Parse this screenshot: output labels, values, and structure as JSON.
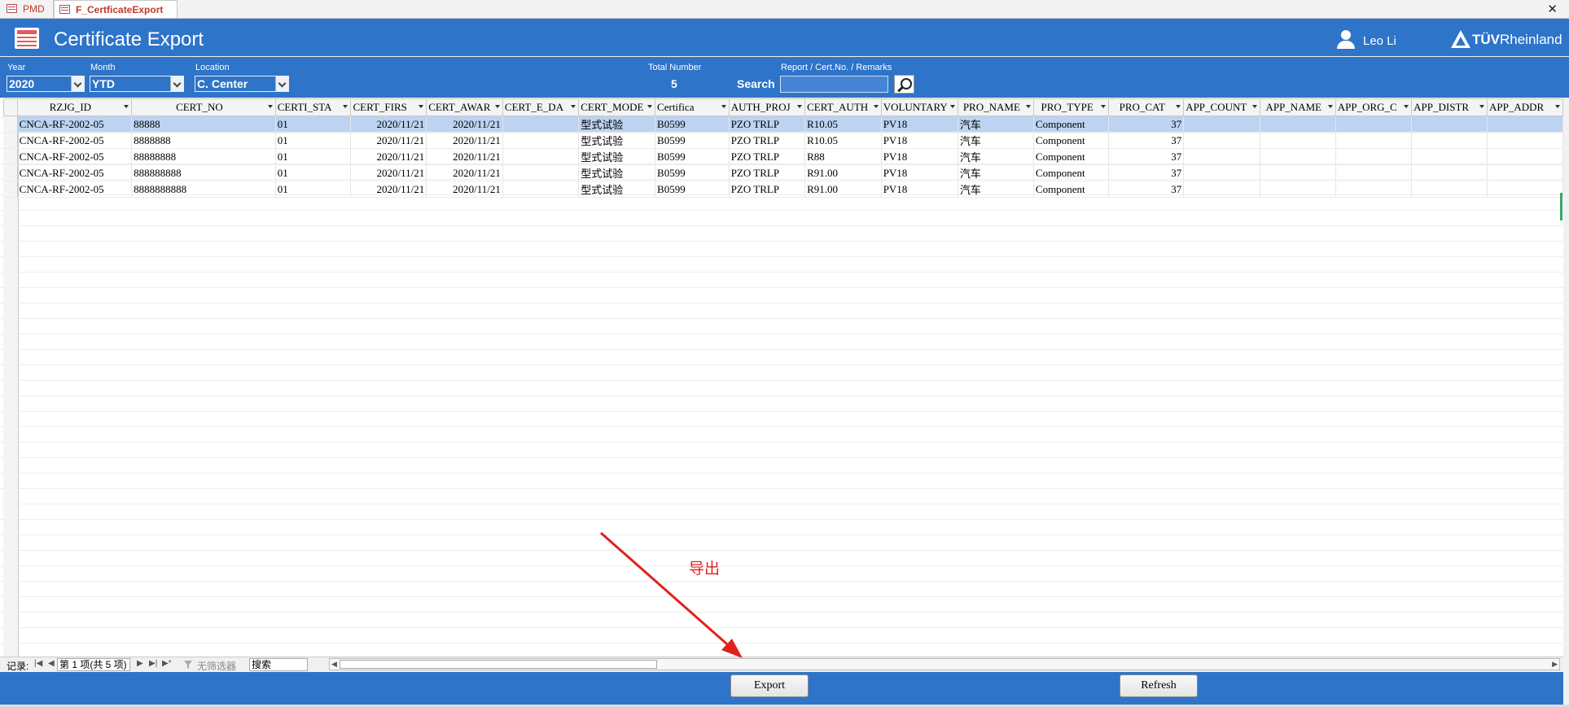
{
  "tabs": [
    {
      "label": "PMD"
    },
    {
      "label": "F_CertficateExport"
    }
  ],
  "header": {
    "title": "Certificate Export",
    "user_name": "Leo Li",
    "logo_text_bold": "TÜV",
    "logo_text_rest": "Rheinland"
  },
  "filters": {
    "year_label": "Year",
    "year_value": "2020",
    "month_label": "Month",
    "month_value": "YTD",
    "location_label": "Location",
    "location_value": "C. Center",
    "total_label": "Total Number",
    "total_value": "5",
    "search_label": "Search",
    "search_field_label": "Report / Cert.No. / Remarks",
    "search_value": ""
  },
  "grid": {
    "columns": [
      "RZJG_ID",
      "CERT_NO",
      "CERTI_STA",
      "CERT_FIRS",
      "CERT_AWAR",
      "CERT_E_DA",
      "CERT_MODE",
      "Certifica",
      "AUTH_PROJ",
      "CERT_AUTH",
      "VOLUNTARY",
      "PRO_NAME",
      "PRO_TYPE",
      "PRO_CAT",
      "APP_COUNT",
      "APP_NAME",
      "APP_ORG_C",
      "APP_DISTR",
      "APP_ADDR"
    ],
    "rows": [
      [
        "CNCA-RF-2002-05",
        "88888",
        "01",
        "2020/11/21",
        "2020/11/21",
        "",
        "型式试验",
        "B0599",
        "PZO TRLP",
        "R10.05",
        "PV18",
        "汽车",
        "Component",
        "37",
        "",
        "",
        "",
        "",
        ""
      ],
      [
        "CNCA-RF-2002-05",
        "8888888",
        "01",
        "2020/11/21",
        "2020/11/21",
        "",
        "型式试验",
        "B0599",
        "PZO TRLP",
        "R10.05",
        "PV18",
        "汽车",
        "Component",
        "37",
        "",
        "",
        "",
        "",
        ""
      ],
      [
        "CNCA-RF-2002-05",
        "88888888",
        "01",
        "2020/11/21",
        "2020/11/21",
        "",
        "型式试验",
        "B0599",
        "PZO TRLP",
        "R88",
        "PV18",
        "汽车",
        "Component",
        "37",
        "",
        "",
        "",
        "",
        ""
      ],
      [
        "CNCA-RF-2002-05",
        "888888888",
        "01",
        "2020/11/21",
        "2020/11/21",
        "",
        "型式试验",
        "B0599",
        "PZO TRLP",
        "R91.00",
        "PV18",
        "汽车",
        "Component",
        "37",
        "",
        "",
        "",
        "",
        ""
      ],
      [
        "CNCA-RF-2002-05",
        "8888888888",
        "01",
        "2020/11/21",
        "2020/11/21",
        "",
        "型式试验",
        "B0599",
        "PZO TRLP",
        "R91.00",
        "PV18",
        "汽车",
        "Component",
        "37",
        "",
        "",
        "",
        "",
        ""
      ]
    ]
  },
  "navigator": {
    "records_label": "记录:",
    "position_text": "第 1 项(共 5 项)",
    "filter_label": "无筛选器",
    "search_placeholder": "搜索"
  },
  "footer": {
    "export_label": "Export",
    "refresh_label": "Refresh"
  },
  "annotation": {
    "text": "导出",
    "color": "#e0221b"
  },
  "colors": {
    "brand_blue": "#2e74c9",
    "selected_row": "#bcd3f1"
  }
}
